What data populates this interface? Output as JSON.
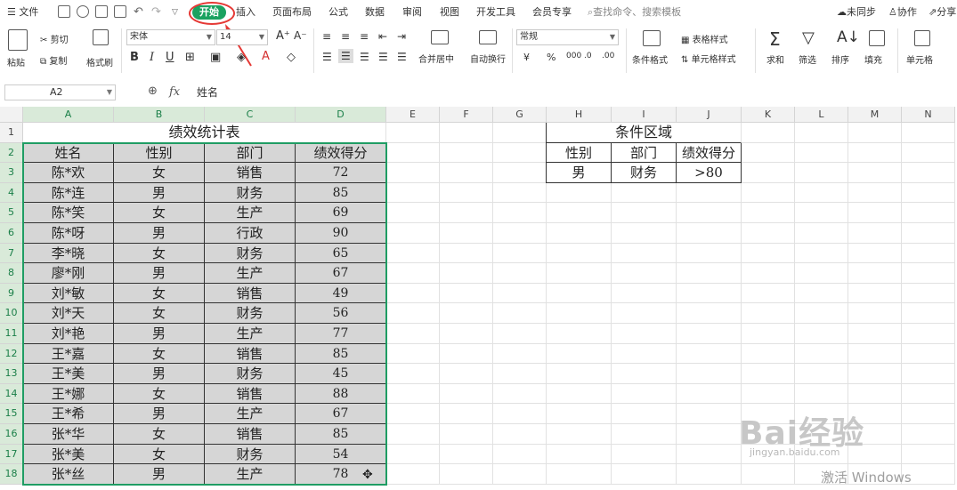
{
  "menubar": {
    "file": "文件",
    "tabs": [
      "开始",
      "插入",
      "页面布局",
      "公式",
      "数据",
      "审阅",
      "视图",
      "开发工具",
      "会员专享"
    ],
    "search": "查找命令、搜索模板",
    "sync": "未同步",
    "collab": "协作",
    "share": "分享"
  },
  "ribbon": {
    "paste": "粘贴",
    "cut": "剪切",
    "copy": "复制",
    "format_painter": "格式刷",
    "font_name": "宋体",
    "font_size": "14",
    "merge_center": "合并居中",
    "wrap_text": "自动换行",
    "number_format": "常规",
    "conditional_format": "条件格式",
    "table_style": "表格样式",
    "cell_style": "单元格样式",
    "sum": "求和",
    "filter": "筛选",
    "sort": "排序",
    "fill": "填充",
    "cells": "单元格",
    "accent_color": "#1aa260",
    "highlight_color": "#e53935"
  },
  "formula_bar": {
    "name_box": "A2",
    "fx": "fx",
    "content": "姓名"
  },
  "columns": [
    "A",
    "B",
    "C",
    "D",
    "E",
    "F",
    "G",
    "H",
    "I",
    "J",
    "K",
    "L",
    "M",
    "N"
  ],
  "rows": [
    "1",
    "2",
    "3",
    "4",
    "5",
    "6",
    "7",
    "8",
    "9",
    "10",
    "11",
    "12",
    "13",
    "14",
    "15",
    "16",
    "17",
    "18"
  ],
  "table": {
    "title": "绩效统计表",
    "headers": [
      "姓名",
      "性别",
      "部门",
      "绩效得分"
    ],
    "rows": [
      [
        "陈*欢",
        "女",
        "销售",
        "72"
      ],
      [
        "陈*连",
        "男",
        "财务",
        "85"
      ],
      [
        "陈*笑",
        "女",
        "生产",
        "69"
      ],
      [
        "陈*呀",
        "男",
        "行政",
        "90"
      ],
      [
        "李*晓",
        "女",
        "财务",
        "65"
      ],
      [
        "廖*刚",
        "男",
        "生产",
        "67"
      ],
      [
        "刘*敏",
        "女",
        "销售",
        "49"
      ],
      [
        "刘*天",
        "女",
        "财务",
        "56"
      ],
      [
        "刘*艳",
        "男",
        "生产",
        "77"
      ],
      [
        "王*嘉",
        "女",
        "销售",
        "85"
      ],
      [
        "王*美",
        "男",
        "财务",
        "45"
      ],
      [
        "王*娜",
        "女",
        "销售",
        "88"
      ],
      [
        "王*希",
        "男",
        "生产",
        "67"
      ],
      [
        "张*华",
        "女",
        "销售",
        "85"
      ],
      [
        "张*美",
        "女",
        "财务",
        "54"
      ],
      [
        "张*丝",
        "男",
        "生产",
        "78"
      ]
    ]
  },
  "criteria": {
    "title": "条件区域",
    "headers": [
      "性别",
      "部门",
      "绩效得分"
    ],
    "values": [
      "男",
      "财务",
      ">80"
    ]
  },
  "watermark": {
    "baidu": "Bai经验",
    "jingyan": "jingyan.baidu.com",
    "activate": "激活 Windows"
  }
}
